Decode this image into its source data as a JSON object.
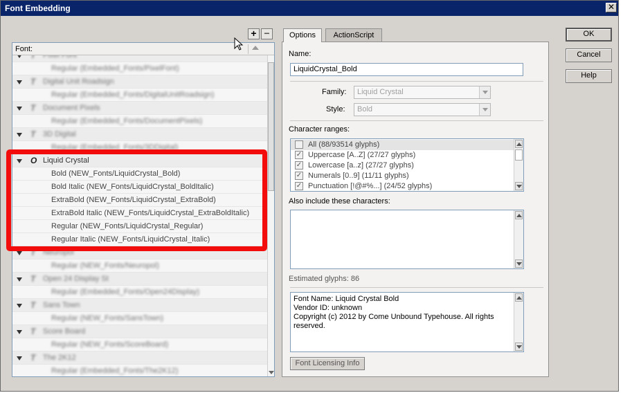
{
  "window": {
    "title": "Font Embedding",
    "close_label": "✕"
  },
  "toolbar": {
    "add_label": "+",
    "remove_label": "−"
  },
  "font_list": {
    "header": "Font:",
    "rows": [
      {
        "kind": "family",
        "label": "Pixel Font",
        "icon": "blue-font-icon",
        "blurred": true
      },
      {
        "kind": "style",
        "label": "Regular (Embedded_Fonts/PixelFont)",
        "blurred": true
      },
      {
        "kind": "family",
        "label": "Digital Unit Roadsign",
        "icon": "green-font-icon",
        "blurred": true
      },
      {
        "kind": "style",
        "label": "Regular (Embedded_Fonts/DigitalUnitRoadsign)",
        "blurred": true
      },
      {
        "kind": "family",
        "label": "Document Pixels",
        "icon": "blue-font-icon",
        "blurred": true
      },
      {
        "kind": "style",
        "label": "Regular (Embedded_Fonts/DocumentPixels)",
        "blurred": true
      },
      {
        "kind": "family",
        "label": "3D Digital",
        "icon": "blue-font-icon",
        "blurred": true
      },
      {
        "kind": "style",
        "label": "Regular (Embedded_Fonts/3DDigital)",
        "blurred": true
      },
      {
        "kind": "family",
        "label": "Liquid Crystal",
        "icon": "opentype-font-icon",
        "blurred": false
      },
      {
        "kind": "style",
        "label": "Bold (NEW_Fonts/LiquidCrystal_Bold)",
        "blurred": false
      },
      {
        "kind": "style",
        "label": "Bold Italic (NEW_Fonts/LiquidCrystal_BoldItalic)",
        "blurred": false
      },
      {
        "kind": "style",
        "label": "ExtraBold (NEW_Fonts/LiquidCrystal_ExtraBold)",
        "blurred": false
      },
      {
        "kind": "style",
        "label": "ExtraBold Italic (NEW_Fonts/LiquidCrystal_ExtraBoldItalic)",
        "blurred": false
      },
      {
        "kind": "style",
        "label": "Regular (NEW_Fonts/LiquidCrystal_Regular)",
        "blurred": false
      },
      {
        "kind": "style",
        "label": "Regular Italic (NEW_Fonts/LiquidCrystal_Italic)",
        "blurred": false
      },
      {
        "kind": "family",
        "label": "Neuropol",
        "icon": "blue-font-icon",
        "blurred": true
      },
      {
        "kind": "style",
        "label": "Regular (NEW_Fonts/Neuropol)",
        "blurred": true
      },
      {
        "kind": "family",
        "label": "Open 24 Display St",
        "icon": "blue-font-icon",
        "blurred": true
      },
      {
        "kind": "style",
        "label": "Regular (Embedded_Fonts/Open24Display)",
        "blurred": true
      },
      {
        "kind": "family",
        "label": "Sans Town",
        "icon": "blue-font-icon",
        "blurred": true
      },
      {
        "kind": "style",
        "label": "Regular (NEW_Fonts/SansTown)",
        "blurred": true
      },
      {
        "kind": "family",
        "label": "Score Board",
        "icon": "blue-font-icon",
        "blurred": true
      },
      {
        "kind": "style",
        "label": "Regular (NEW_Fonts/ScoreBoard)",
        "blurred": true
      },
      {
        "kind": "family",
        "label": "The 2K12",
        "icon": "blue-font-icon",
        "blurred": true
      },
      {
        "kind": "style",
        "label": "Regular (Embedded_Fonts/The2K12)",
        "blurred": true
      }
    ]
  },
  "tabs": [
    {
      "label": "Options",
      "active": true
    },
    {
      "label": "ActionScript",
      "active": false
    }
  ],
  "options": {
    "name_label": "Name:",
    "name_value": "LiquidCrystal_Bold",
    "family_label": "Family:",
    "family_value": "Liquid Crystal",
    "style_label": "Style:",
    "style_value": "Bold",
    "char_ranges_label": "Character ranges:",
    "char_ranges": [
      {
        "label": "All  (88/93514 glyphs)",
        "checked": false
      },
      {
        "label": "Uppercase [A..Z]  (27/27 glyphs)",
        "checked": true
      },
      {
        "label": "Lowercase [a..z]  (27/27 glyphs)",
        "checked": true
      },
      {
        "label": "Numerals [0..9]  (11/11 glyphs)",
        "checked": true
      },
      {
        "label": "Punctuation [!@#%...]  (24/52 glyphs)",
        "checked": true
      }
    ],
    "also_include_label": "Also include these characters:",
    "also_include_value": "",
    "estimated_glyphs": "Estimated glyphs: 86",
    "font_info": "Font Name: Liquid Crystal Bold\nVendor ID: unknown\nCopyright (c) 2012 by Come Unbound Typehouse. All rights reserved.",
    "licensing_button": "Font Licensing Info"
  },
  "buttons": {
    "ok": "OK",
    "cancel": "Cancel",
    "help": "Help"
  },
  "colors": {
    "titlebar": "#0a246a",
    "highlight": "#f20c0c",
    "dialog_bg": "#d6d3ce"
  }
}
